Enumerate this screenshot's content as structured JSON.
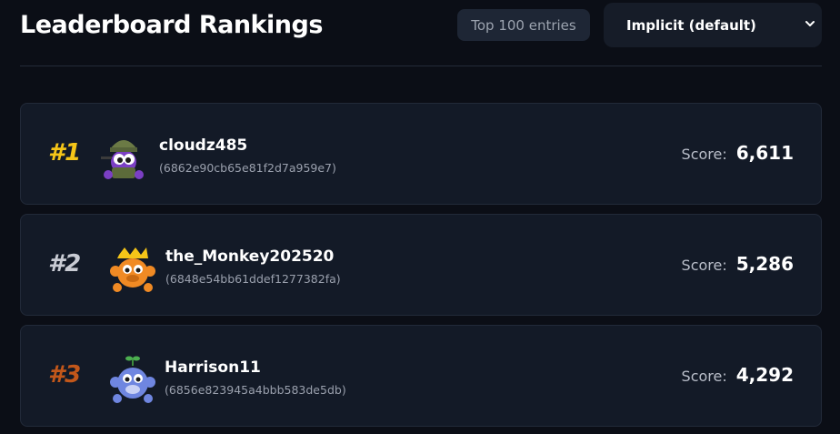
{
  "header": {
    "title": "Leaderboard Rankings",
    "entries_badge": "Top 100 entries",
    "mode_select": {
      "selected": "Implicit (default)"
    }
  },
  "entries": [
    {
      "rank": "#1",
      "name": "cloudz485",
      "id": "(6862e90cb65e81f2d7a959e7)",
      "score_label": "Score:",
      "score": "6,611",
      "rank_color": "#f5c518",
      "avatar": "purple-monkey-soldier-icon"
    },
    {
      "rank": "#2",
      "name": "the_Monkey202520",
      "id": "(6848e54bb61ddef1277382fa)",
      "score_label": "Score:",
      "score": "5,286",
      "rank_color": "#c9ccd4",
      "avatar": "orange-monkey-crown-icon"
    },
    {
      "rank": "#3",
      "name": "Harrison11",
      "id": "(6856e823945a4bbb583de5db)",
      "score_label": "Score:",
      "score": "4,292",
      "rank_color": "#c2571a",
      "avatar": "blue-monkey-sprout-icon"
    }
  ]
}
